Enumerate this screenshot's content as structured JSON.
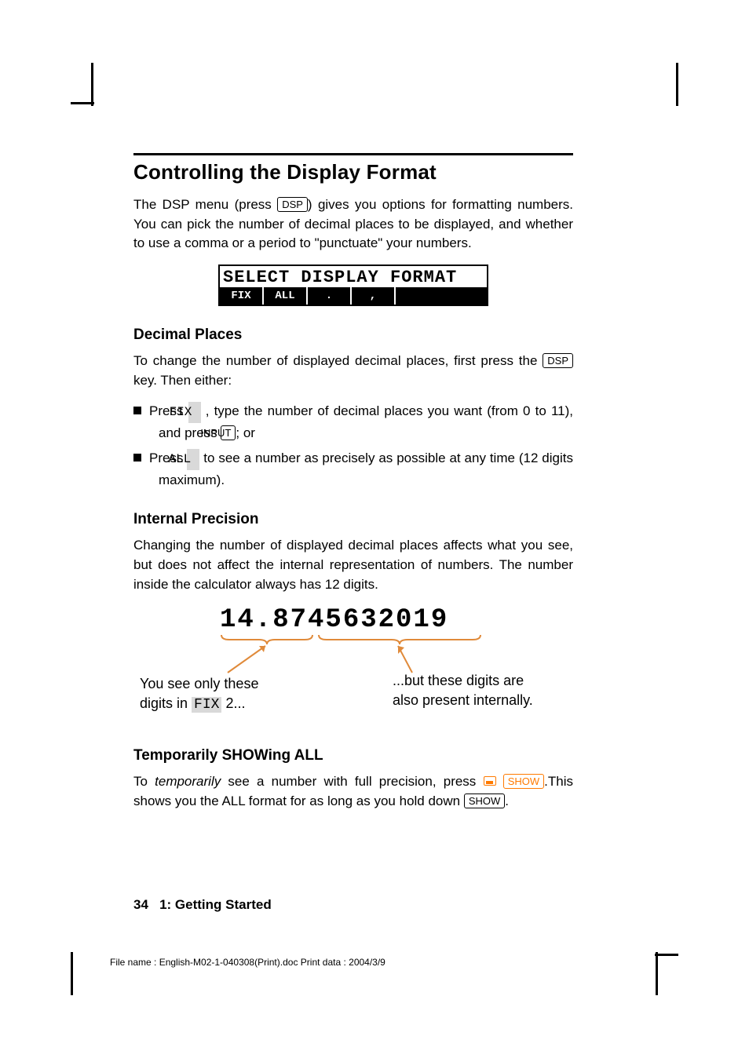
{
  "heading": "Controlling the Display Format",
  "intro_a": "The DSP menu (press ",
  "intro_key": "DSP",
  "intro_b": ") gives you options for formatting numbers. You can pick the number of decimal places to be displayed, and whether to use a comma or a period to \"punctuate\" your numbers.",
  "lcd_title": "SELECT DISPLAY FORMAT",
  "lcd_menu": [
    "FIX",
    "ALL",
    ".",
    ","
  ],
  "sec1": "Decimal Places",
  "sec1_p_a": "To change the number of displayed decimal places, first press the ",
  "sec1_p_key": "DSP",
  "sec1_p_b": " key. Then either:",
  "li1_a": "Press ",
  "li1_soft": "FIX",
  "li1_b": " , type the number of decimal places you want (from 0 to 11), and press ",
  "li1_key": "INPUT",
  "li1_c": "; or",
  "li2_a": "Press ",
  "li2_soft": "ALL",
  "li2_b": " to see a number as precisely as possible at any time (12 digits maximum).",
  "sec2": "Internal Precision",
  "sec2_p": "Changing the number of displayed decimal places affects what you see, but does not affect the internal representation of numbers. The number inside the calculator always has 12 digits.",
  "bignum": "14.8745632019",
  "ann_left_a": "You see only these",
  "ann_left_b": "digits in ",
  "ann_left_soft": "FIX",
  "ann_left_c": " 2...",
  "ann_right_a": "...but these digits are",
  "ann_right_b": "also present internally.",
  "sec3": "Temporarily SHOWing ALL",
  "sec3_a": "To ",
  "sec3_ital": "temporarily",
  "sec3_b": " see a number with full precision, press ",
  "sec3_key": "SHOW",
  "sec3_c": ".This shows you the ALL format for as long as you hold down ",
  "sec3_key2": "SHOW",
  "sec3_d": ".",
  "page_num": "34",
  "chapter": "1: Getting Started",
  "meta": "File name : English-M02-1-040308(Print).doc    Print data : 2004/3/9"
}
